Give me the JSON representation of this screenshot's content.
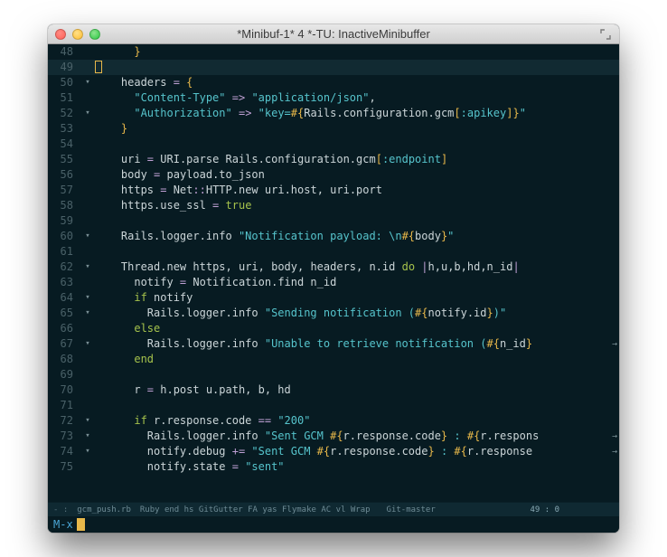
{
  "window": {
    "title": "*Minibuf-1* 4 *-TU: InactiveMinibuffer"
  },
  "lines": [
    {
      "num": "48",
      "fold": "",
      "tokens": [
        [
          "      ",
          ""
        ],
        [
          "}",
          "tok-brace"
        ]
      ]
    },
    {
      "num": "49",
      "fold": "",
      "bg": true,
      "cursor_outline": true,
      "tokens": []
    },
    {
      "num": "50",
      "fold": "▾",
      "tokens": [
        [
          "    headers ",
          ""
        ],
        [
          "= ",
          "tok-op"
        ],
        [
          "{",
          "tok-brace"
        ]
      ]
    },
    {
      "num": "51",
      "fold": "",
      "tokens": [
        [
          "      ",
          ""
        ],
        [
          "\"Content-Type\"",
          "tok-str"
        ],
        [
          " ",
          ""
        ],
        [
          "=>",
          "tok-op"
        ],
        [
          " ",
          ""
        ],
        [
          "\"application/json\"",
          "tok-str"
        ],
        [
          ",",
          ""
        ]
      ]
    },
    {
      "num": "52",
      "fold": "▾",
      "tokens": [
        [
          "      ",
          ""
        ],
        [
          "\"Authorization\"",
          "tok-str"
        ],
        [
          " ",
          ""
        ],
        [
          "=>",
          "tok-op"
        ],
        [
          " ",
          ""
        ],
        [
          "\"key=",
          "tok-str"
        ],
        [
          "#{",
          "tok-brace"
        ],
        [
          "Rails.configuration.gcm",
          "tok-plain"
        ],
        [
          "[",
          "tok-brace"
        ],
        [
          ":apikey",
          "tok-str"
        ],
        [
          "]",
          "tok-brace"
        ],
        [
          "}",
          "tok-brace"
        ],
        [
          "\"",
          "tok-str"
        ]
      ]
    },
    {
      "num": "53",
      "fold": "",
      "tokens": [
        [
          "    ",
          ""
        ],
        [
          "}",
          "tok-brace"
        ]
      ]
    },
    {
      "num": "54",
      "fold": "",
      "tokens": []
    },
    {
      "num": "55",
      "fold": "",
      "tokens": [
        [
          "    uri ",
          ""
        ],
        [
          "=",
          "tok-op"
        ],
        [
          " URI",
          ""
        ],
        [
          ".",
          "tok-plain"
        ],
        [
          "parse ",
          ""
        ],
        [
          "Rails",
          ""
        ],
        [
          ".configuration.gcm",
          ""
        ],
        [
          "[",
          "tok-brace"
        ],
        [
          ":endpoint",
          "tok-str"
        ],
        [
          "]",
          "tok-brace"
        ]
      ]
    },
    {
      "num": "56",
      "fold": "",
      "tokens": [
        [
          "    body ",
          ""
        ],
        [
          "=",
          "tok-op"
        ],
        [
          " payload.to_json",
          ""
        ]
      ]
    },
    {
      "num": "57",
      "fold": "",
      "tokens": [
        [
          "    https ",
          ""
        ],
        [
          "=",
          "tok-op"
        ],
        [
          " Net",
          ""
        ],
        [
          "::",
          "tok-op"
        ],
        [
          "HTTP",
          ""
        ],
        [
          ".",
          "tok-plain"
        ],
        [
          "new",
          ""
        ],
        [
          " uri.host, uri.port",
          ""
        ]
      ]
    },
    {
      "num": "58",
      "fold": "",
      "tokens": [
        [
          "    https.use_ssl ",
          ""
        ],
        [
          "=",
          "tok-op"
        ],
        [
          " ",
          ""
        ],
        [
          "true",
          "tok-kw"
        ]
      ]
    },
    {
      "num": "59",
      "fold": "",
      "tokens": []
    },
    {
      "num": "60",
      "fold": "▾",
      "tokens": [
        [
          "    Rails.logger.info ",
          ""
        ],
        [
          "\"Notification payload: \\n",
          "tok-str"
        ],
        [
          "#{",
          "tok-brace"
        ],
        [
          "body",
          ""
        ],
        [
          "}",
          "tok-brace"
        ],
        [
          "\"",
          "tok-str"
        ]
      ]
    },
    {
      "num": "61",
      "fold": "",
      "tokens": []
    },
    {
      "num": "62",
      "fold": "▾",
      "tokens": [
        [
          "    Thread",
          ""
        ],
        [
          ".",
          "tok-plain"
        ],
        [
          "new",
          ""
        ],
        [
          " https, uri, body, headers, n.id ",
          ""
        ],
        [
          "do",
          "tok-kw"
        ],
        [
          " ",
          ""
        ],
        [
          "|",
          "tok-block"
        ],
        [
          "h,u,b,hd,n_id",
          ""
        ],
        [
          "|",
          "tok-block"
        ]
      ]
    },
    {
      "num": "63",
      "fold": "",
      "tokens": [
        [
          "      notify ",
          ""
        ],
        [
          "=",
          "tok-op"
        ],
        [
          " Notification",
          ""
        ],
        [
          ".",
          "tok-plain"
        ],
        [
          "find n_id",
          ""
        ]
      ]
    },
    {
      "num": "64",
      "fold": "▾",
      "tokens": [
        [
          "      ",
          ""
        ],
        [
          "if",
          "tok-kw"
        ],
        [
          " notify",
          ""
        ]
      ]
    },
    {
      "num": "65",
      "fold": "▾",
      "tokens": [
        [
          "        Rails.logger.info ",
          ""
        ],
        [
          "\"Sending notification (",
          "tok-str"
        ],
        [
          "#{",
          "tok-brace"
        ],
        [
          "notify.id",
          ""
        ],
        [
          "}",
          "tok-brace"
        ],
        [
          ")\"",
          "tok-str"
        ]
      ]
    },
    {
      "num": "66",
      "fold": "",
      "tokens": [
        [
          "      ",
          ""
        ],
        [
          "else",
          "tok-kw"
        ]
      ]
    },
    {
      "num": "67",
      "fold": "▾",
      "wrap": true,
      "tokens": [
        [
          "        Rails.logger.info ",
          ""
        ],
        [
          "\"Unable to retrieve notification (",
          "tok-str"
        ],
        [
          "#{",
          "tok-brace"
        ],
        [
          "n_id",
          ""
        ],
        [
          "}",
          "tok-brace"
        ]
      ]
    },
    {
      "num": "68",
      "fold": "",
      "tokens": [
        [
          "      ",
          ""
        ],
        [
          "end",
          "tok-kw"
        ]
      ]
    },
    {
      "num": "69",
      "fold": "",
      "tokens": []
    },
    {
      "num": "70",
      "fold": "",
      "tokens": [
        [
          "      r ",
          ""
        ],
        [
          "=",
          "tok-op"
        ],
        [
          " h.post u.path, b, hd",
          ""
        ]
      ]
    },
    {
      "num": "71",
      "fold": "",
      "tokens": []
    },
    {
      "num": "72",
      "fold": "▾",
      "tokens": [
        [
          "      ",
          ""
        ],
        [
          "if",
          "tok-kw"
        ],
        [
          " r.response.code ",
          ""
        ],
        [
          "==",
          "tok-op"
        ],
        [
          " ",
          ""
        ],
        [
          "\"200\"",
          "tok-str"
        ]
      ]
    },
    {
      "num": "73",
      "fold": "▾",
      "wrap": true,
      "tokens": [
        [
          "        Rails.logger.info ",
          ""
        ],
        [
          "\"Sent GCM ",
          "tok-str"
        ],
        [
          "#{",
          "tok-brace"
        ],
        [
          "r.response.code",
          ""
        ],
        [
          "}",
          "tok-brace"
        ],
        [
          " : ",
          "tok-str"
        ],
        [
          "#{",
          "tok-brace"
        ],
        [
          "r.respons",
          ""
        ]
      ]
    },
    {
      "num": "74",
      "fold": "▾",
      "wrap": true,
      "tokens": [
        [
          "        notify.debug ",
          ""
        ],
        [
          "+=",
          "tok-op"
        ],
        [
          " ",
          ""
        ],
        [
          "\"Sent GCM ",
          "tok-str"
        ],
        [
          "#{",
          "tok-brace"
        ],
        [
          "r.response.code",
          ""
        ],
        [
          "}",
          "tok-brace"
        ],
        [
          " : ",
          "tok-str"
        ],
        [
          "#{",
          "tok-brace"
        ],
        [
          "r.response",
          ""
        ]
      ]
    },
    {
      "num": "75",
      "fold": "",
      "tokens": [
        [
          "        notify.state ",
          ""
        ],
        [
          "=",
          "tok-op"
        ],
        [
          " ",
          ""
        ],
        [
          "\"sent\"",
          "tok-str"
        ]
      ]
    }
  ],
  "modeline": {
    "file": "gcm_push.rb",
    "minor": "Ruby end hs GitGutter FA yas Flymake AC vl Wrap",
    "vc": "Git-master",
    "pos": "49 : 0"
  },
  "minibuffer": {
    "prompt": "M-x"
  }
}
